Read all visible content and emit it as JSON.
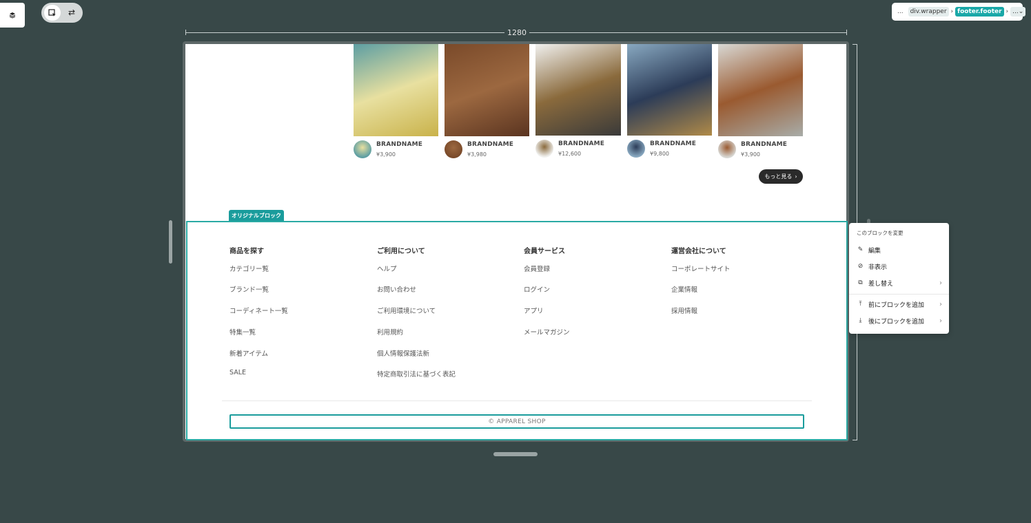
{
  "ruler": {
    "width_label": "1280"
  },
  "breadcrumb": {
    "ellipsis": "...",
    "items": [
      "div.wrapper",
      "footer.footer",
      "..."
    ]
  },
  "products": [
    {
      "brand": "BRANDNAME",
      "price": "¥3,900",
      "photo_colors": [
        "#5d9ea2",
        "#e8e0a0",
        "#c9b24a"
      ]
    },
    {
      "brand": "BRANDNAME",
      "price": "¥3,980",
      "photo_colors": [
        "#7a4a2a",
        "#9c6840",
        "#5a3420"
      ]
    },
    {
      "brand": "BRANDNAME",
      "price": "¥12,600",
      "photo_colors": [
        "#f0f0ee",
        "#8a6a3c",
        "#3a3a3a"
      ]
    },
    {
      "brand": "BRANDNAME",
      "price": "¥9,800",
      "photo_colors": [
        "#88a8c0",
        "#2c3c58",
        "#b08a48"
      ]
    },
    {
      "brand": "BRANDNAME",
      "price": "¥3,900",
      "photo_colors": [
        "#d8d8d4",
        "#9a5a30",
        "#a8aca8"
      ]
    }
  ],
  "more_button": {
    "label": "もっと見る",
    "icon": "chevron-right-icon"
  },
  "original_block_tag": "オリジナルブロック",
  "footer": {
    "columns": [
      {
        "heading": "商品を探す",
        "links": [
          "カテゴリー覧",
          "ブランド一覧",
          "コーディネート一覧",
          "特集一覧",
          "新着アイテム",
          "SALE"
        ]
      },
      {
        "heading": "ご利用について",
        "links": [
          "ヘルプ",
          "お問い合わせ",
          "ご利用環境について",
          "利用規約",
          "個人情報保護法新",
          "特定商取引法に基づく表記"
        ]
      },
      {
        "heading": "会員サービス",
        "links": [
          "会員登録",
          "ログイン",
          "アプリ",
          "メールマガジン"
        ]
      },
      {
        "heading": "運営会社について",
        "links": [
          "コーポレートサイト",
          "企業情報",
          "採用情報"
        ]
      }
    ],
    "copyright": "© APPAREL SHOP"
  },
  "context_menu": {
    "title": "このブロックを変更",
    "items": [
      {
        "label": "編集",
        "icon": "pencil-icon"
      },
      {
        "label": "非表示",
        "icon": "eye-off-icon"
      },
      {
        "label": "差し替え",
        "icon": "replace-icon"
      },
      {
        "label": "前にブロックを追加",
        "icon": "insert-before-icon"
      },
      {
        "label": "後にブロックを追加",
        "icon": "insert-after-icon"
      }
    ]
  },
  "colors": {
    "background": "#384848",
    "accent": "#1a9c9c",
    "canvas": "#ffffff"
  }
}
